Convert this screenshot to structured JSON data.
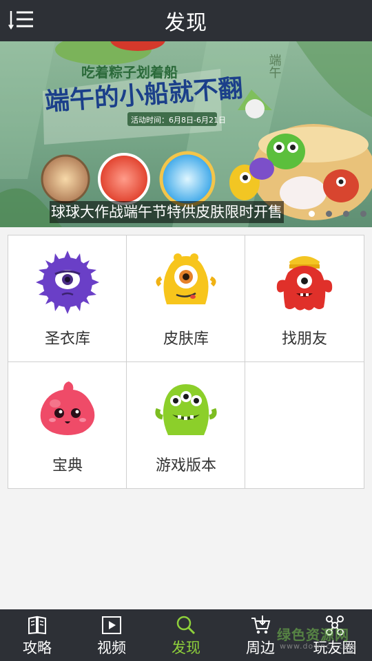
{
  "header": {
    "title": "发现",
    "menu_icon": "list-menu-icon"
  },
  "banner": {
    "caption": "球球大作战端午节特供皮肤限时开售",
    "headline_small": "吃着粽子划着船",
    "headline_big": "端午的小船就不翻",
    "activity_time": "活动时间：6月8日-6月21日",
    "side_text": "端午",
    "slide_count": 4,
    "active_slide": 1
  },
  "grid": {
    "items": [
      {
        "label": "圣衣库",
        "icon": "purple-monster-icon"
      },
      {
        "label": "皮肤库",
        "icon": "yellow-monster-icon"
      },
      {
        "label": "找朋友",
        "icon": "red-monster-icon"
      },
      {
        "label": "宝典",
        "icon": "pink-blob-icon"
      },
      {
        "label": "游戏版本",
        "icon": "green-monster-icon"
      }
    ]
  },
  "tabbar": {
    "tabs": [
      {
        "label": "攻略",
        "icon": "book-icon",
        "active": false
      },
      {
        "label": "视频",
        "icon": "play-icon",
        "active": false
      },
      {
        "label": "发现",
        "icon": "search-icon",
        "active": true
      },
      {
        "label": "周边",
        "icon": "cart-icon",
        "active": false
      },
      {
        "label": "玩友圈",
        "icon": "share-icon",
        "active": false
      }
    ]
  },
  "watermark": {
    "text": "绿色资源网",
    "sub": "www.downcc.com"
  },
  "colors": {
    "bar_bg": "#2d3036",
    "accent_green": "#8fd13b",
    "page_bg": "#f3f3f3"
  }
}
